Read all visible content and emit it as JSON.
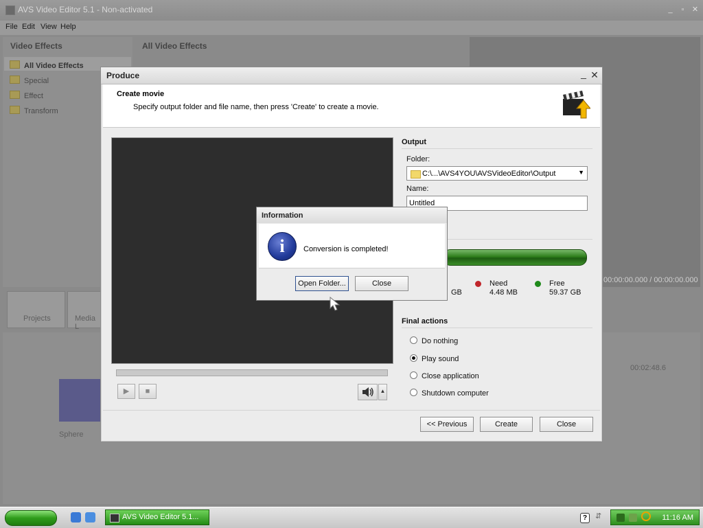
{
  "app": {
    "title": "AVS Video Editor 5.1 - Non-activated",
    "menu": [
      "File",
      "Edit",
      "View",
      "Help"
    ],
    "left_panel_title": "Video Effects",
    "effects_tree": [
      "All Video Effects",
      "Special",
      "Effect",
      "Transform"
    ],
    "center_panel_title": "All Video Effects",
    "timecode": "00:00:00.000 / 00:00:00.000",
    "timeline_time": "00:02:48.6",
    "track_label": "Sphere",
    "bottom_buttons": [
      "Projects",
      "Media L"
    ]
  },
  "produce": {
    "title": "Produce",
    "header_title": "Create movie",
    "header_desc": "Specify output folder and file name, then press 'Create' to create a movie.",
    "output_title": "Output",
    "folder_label": "Folder:",
    "folder_value": "C:\\...\\AVS4YOU\\AVSVideoEditor\\Output",
    "name_label": "Name:",
    "name_value": "Untitled",
    "disk": {
      "used_fraction": 0.03,
      "used_partial": "GB",
      "need_label": "Need",
      "need_value": "4.48 MB",
      "free_label": "Free",
      "free_value": "59.37 GB",
      "colors": {
        "used": "#1c3f8d",
        "need": "#c0262b",
        "free": "#1f8a1a"
      }
    },
    "final_actions_title": "Final actions",
    "final_actions": [
      {
        "label": "Do nothing",
        "checked": false
      },
      {
        "label": "Play sound",
        "checked": true
      },
      {
        "label": "Close application",
        "checked": false
      },
      {
        "label": "Shutdown computer",
        "checked": false
      }
    ],
    "buttons": {
      "previous": "<< Previous",
      "create": "Create",
      "close": "Close"
    }
  },
  "info": {
    "title": "Information",
    "message": "Conversion is completed!",
    "icon": "info-icon",
    "open_folder": "Open Folder...",
    "close": "Close"
  },
  "taskbar": {
    "task_label": "AVS Video Editor 5.1...",
    "clock": "11:16 AM"
  }
}
